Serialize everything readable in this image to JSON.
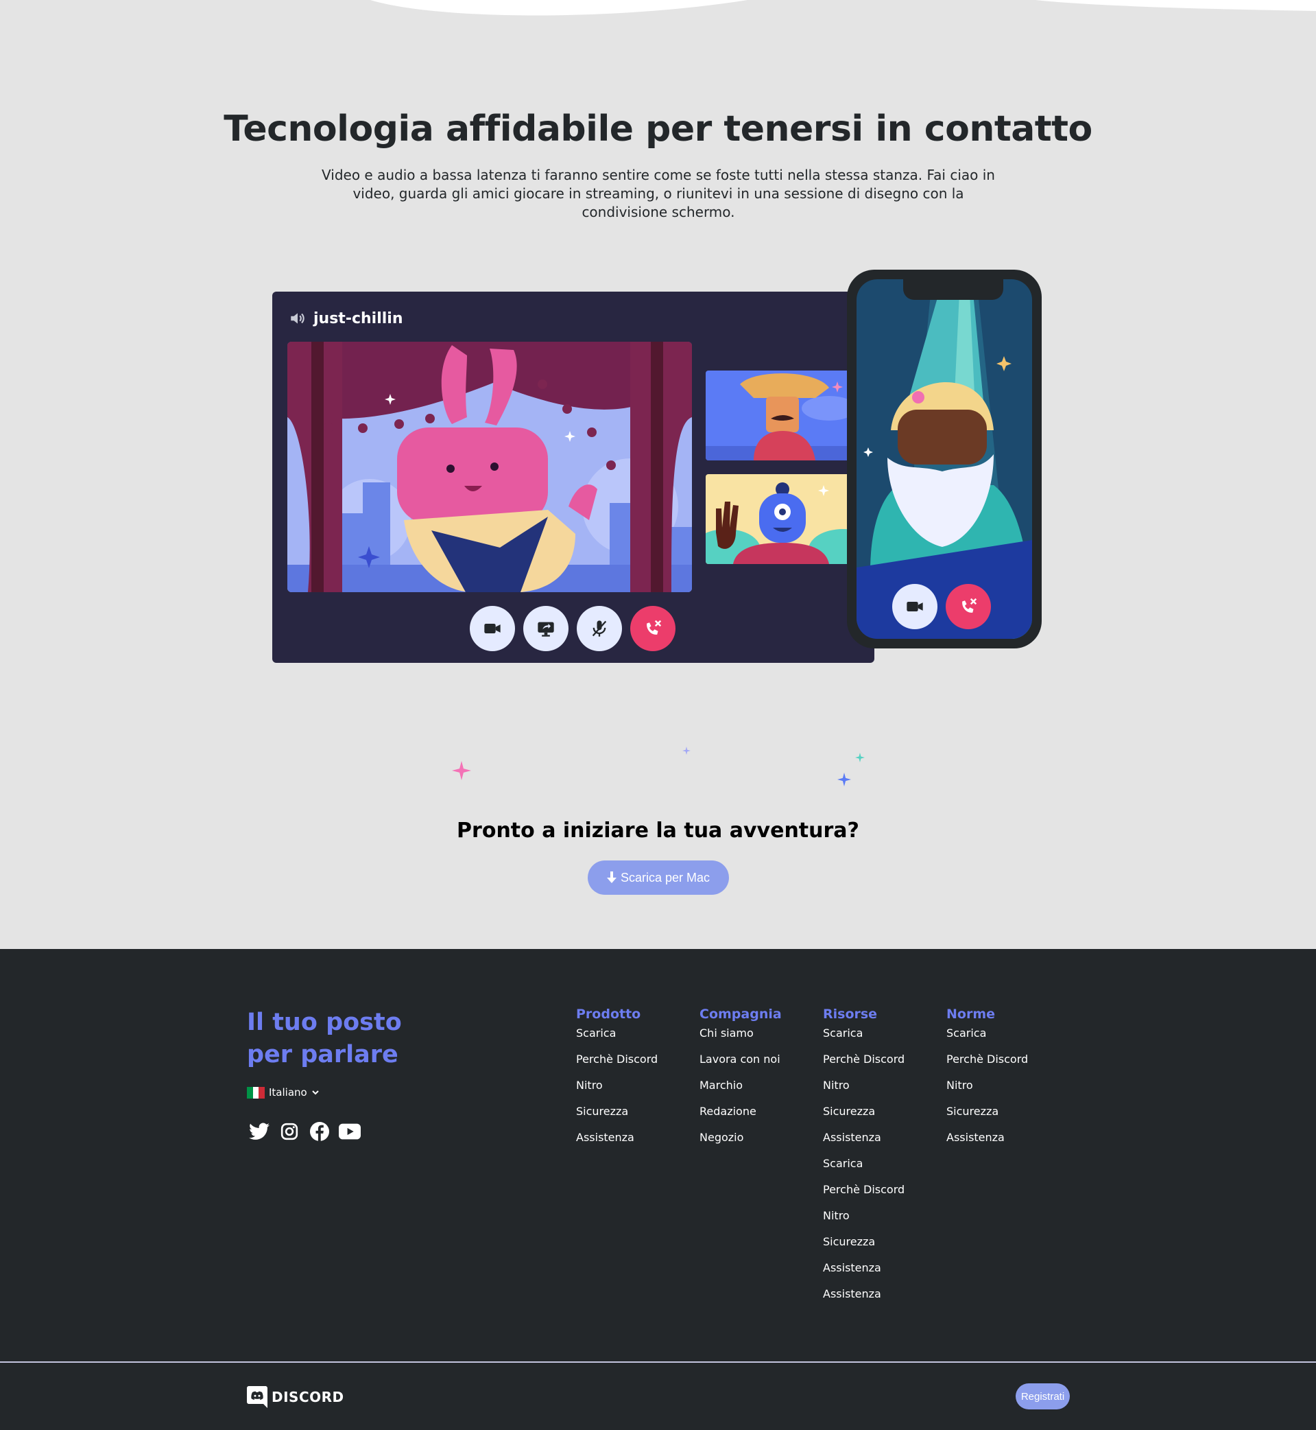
{
  "hero": {
    "title": "Tecnologia affidabile per tenersi in contatto",
    "description": "Video e audio a bassa latenza ti faranno sentire come se foste tutti nella stessa stanza. Fai ciao in video, guarda gli amici giocare in streaming, o riunitevi in una sessione di disegno con la condivisione schermo."
  },
  "illustration": {
    "channel_name": "just-chillin",
    "channel_icon": "speaker-icon",
    "desktop_controls": [
      "camera-icon",
      "screen-share-icon",
      "mic-muted-icon",
      "end-call-icon"
    ],
    "phone_controls": [
      "camera-icon",
      "end-call-icon"
    ]
  },
  "cta": {
    "title": "Pronto a iniziare la tua avventura?",
    "button_label": "Scarica per Mac",
    "button_icon": "download-icon"
  },
  "footer": {
    "slogan": "Il tuo posto per parlare",
    "language": "Italiano",
    "socials": [
      "twitter-icon",
      "instagram-icon",
      "facebook-icon",
      "youtube-icon"
    ],
    "columns": [
      {
        "title": "Prodotto",
        "links": [
          "Scarica",
          "Perchè Discord",
          "Nitro",
          "Sicurezza",
          "Assistenza"
        ]
      },
      {
        "title": "Compagnia",
        "links": [
          "Chi siamo",
          "Lavora con noi",
          "Marchio",
          "Redazione",
          "Negozio"
        ]
      },
      {
        "title": "Risorse",
        "links": [
          "Scarica",
          "Perchè Discord",
          "Nitro",
          "Sicurezza",
          "Assistenza",
          "Scarica",
          "Perchè Discord",
          "Nitro",
          "Sicurezza",
          "Assistenza",
          "Assistenza"
        ]
      },
      {
        "title": "Norme",
        "links": [
          "Scarica",
          "Perchè Discord",
          "Nitro",
          "Sicurezza",
          "Assistenza"
        ]
      }
    ],
    "logo_text": "DISCORD",
    "register_label": "Registrati"
  },
  "colors": {
    "background": "#e4e4e4",
    "footer_bg": "#23272a",
    "brand": "#6d7df0",
    "cta_button": "#8c9eec",
    "call_panel": "#282641",
    "end_call": "#ec3d6b"
  }
}
